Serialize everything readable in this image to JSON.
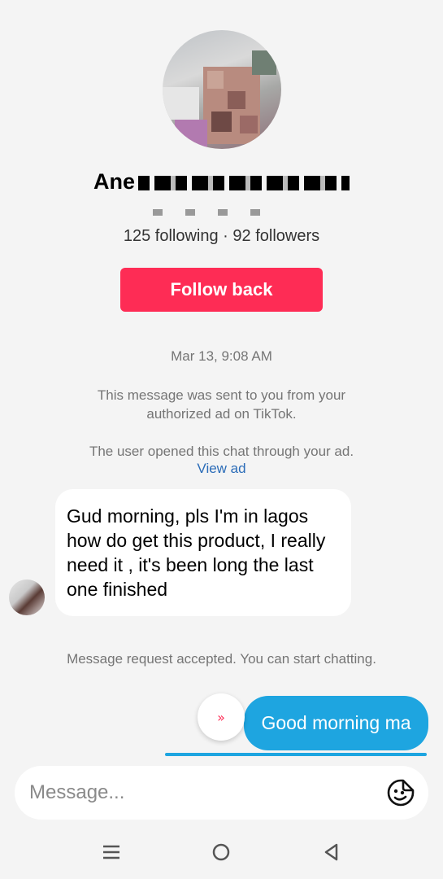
{
  "profile": {
    "display_name": "Ane",
    "stats": "125 following · 92 followers",
    "follow_button": "Follow back"
  },
  "chat": {
    "timestamp": "Mar 13, 9:08 AM",
    "ad_notice": "This message was sent to you from your authorized ad on TikTok.",
    "opened_notice": "The user opened this chat through your ad.",
    "view_ad_link": "View ad",
    "incoming_message": "Gud morning,  pls I'm in lagos how do get this product, I really need it , it's been long the last one finished",
    "accepted_notice": "Message request accepted. You can start chatting.",
    "outgoing_message": "Good morning ma"
  },
  "composer": {
    "placeholder": "Message..."
  },
  "icons": {
    "scroll_down": "double-chevron-down-icon",
    "sticker": "sticker-face-icon",
    "nav_recents": "recents-icon",
    "nav_home": "home-icon",
    "nav_back": "back-icon"
  },
  "colors": {
    "accent": "#fe2c55",
    "outgoing_bubble": "#1ea5e0",
    "link": "#2b6cb8"
  }
}
